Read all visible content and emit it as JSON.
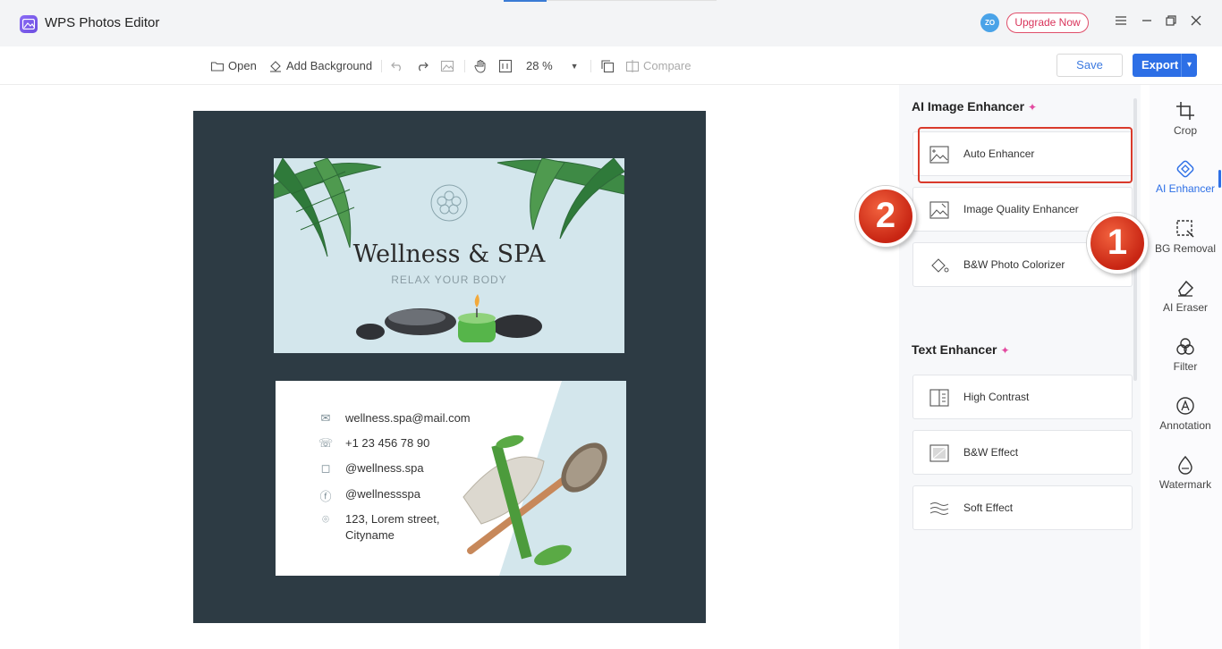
{
  "app": {
    "title": "WPS Photos Editor",
    "avatar_initials": "ZO",
    "upgrade_label": "Upgrade Now"
  },
  "window_controls": {
    "menu": "menu-icon",
    "minimize": "minimize-icon",
    "restore": "restore-icon",
    "close": "close-icon"
  },
  "toolbar": {
    "open_label": "Open",
    "add_background_label": "Add Background",
    "zoom_value": "28 %",
    "compare_label": "Compare",
    "save_label": "Save",
    "export_label": "Export"
  },
  "canvas": {
    "front": {
      "title": "Wellness & SPA",
      "subtitle": "RELAX YOUR BODY"
    },
    "back": {
      "email": "wellness.spa@mail.com",
      "phone": "+1 23 456 78 90",
      "instagram": "@wellness.spa",
      "facebook": "@wellnessspa",
      "address_line1": "123, Lorem street,",
      "address_line2": "Cityname"
    }
  },
  "panel": {
    "ai_section_title": "AI Image Enhancer",
    "ai_tools": [
      {
        "label": "Auto Enhancer"
      },
      {
        "label": "Image Quality Enhancer"
      },
      {
        "label": "B&W Photo Colorizer"
      }
    ],
    "text_section_title": "Text Enhancer",
    "text_tools": [
      {
        "label": "High Contrast"
      },
      {
        "label": "B&W Effect"
      },
      {
        "label": "Soft Effect"
      }
    ]
  },
  "rail": {
    "items": [
      {
        "label": "Crop",
        "icon": "crop-icon"
      },
      {
        "label": "AI Enhancer",
        "icon": "ai-enhancer-icon",
        "active": true
      },
      {
        "label": "BG Removal",
        "icon": "bg-removal-icon"
      },
      {
        "label": "AI Eraser",
        "icon": "eraser-icon"
      },
      {
        "label": "Filter",
        "icon": "filter-icon"
      },
      {
        "label": "Annotation",
        "icon": "annotation-icon"
      },
      {
        "label": "Watermark",
        "icon": "watermark-icon"
      }
    ]
  },
  "annotations": {
    "step1": "1",
    "step2": "2"
  },
  "colors": {
    "accent": "#2d6fe6",
    "highlight": "#d93a2b",
    "upgrade": "#d9345b",
    "canvas_bg": "#2d3b44"
  }
}
